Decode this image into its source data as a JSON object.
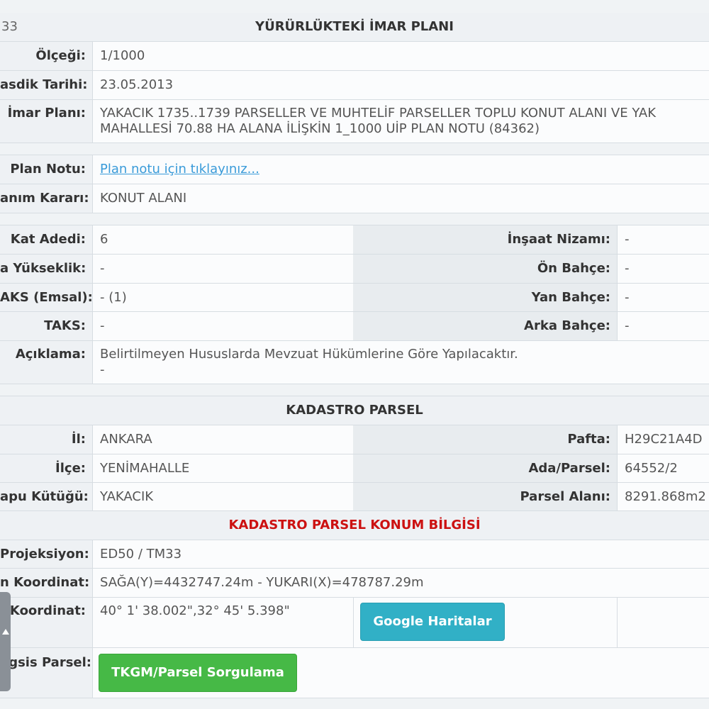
{
  "imar": {
    "header": {
      "left_text": "33",
      "title": "YÜRÜRLÜKTEKİ İMAR PLANI"
    },
    "olcek": {
      "label": "Ölçeği:",
      "value": "1/1000"
    },
    "tasdik": {
      "label": "asdik Tarihi:",
      "value": "23.05.2013"
    },
    "plan": {
      "label": "İmar Planı:",
      "line1": "YAKACIK 1735..1739 PARSELLER VE MUHTELİF PARSELLER TOPLU KONUT ALANI VE YAK",
      "line2": "MAHALLESİ 70.88 HA ALANA İLİŞKİN 1_1000 UİP PLAN NOTU (84362)"
    },
    "plan_notu": {
      "label": "Plan Notu:",
      "link": "Plan notu için tıklayınız..."
    },
    "kullanim": {
      "label": "anım Kararı:",
      "value": "KONUT ALANI"
    },
    "kat": {
      "label": "Kat Adedi:",
      "value": "6",
      "label2": "İnşaat Nizamı:",
      "value2": "-"
    },
    "yukseklik": {
      "label": "a Yükseklik:",
      "value": "-",
      "label2": "Ön Bahçe:",
      "value2": "-"
    },
    "kaks": {
      "label": "AKS (Emsal):",
      "value": "- (1)",
      "label2": "Yan Bahçe:",
      "value2": "-"
    },
    "taks": {
      "label": "TAKS:",
      "value": "-",
      "label2": "Arka Bahçe:",
      "value2": "-"
    },
    "aciklama": {
      "label": "Açıklama:",
      "line1": "Belirtilmeyen Hususlarda Mevzuat Hükümlerine Göre Yapılacaktır.",
      "line2": "-"
    }
  },
  "kadastro": {
    "title": "KADASTRO PARSEL",
    "il": {
      "label": "İl:",
      "value": "ANKARA",
      "label2": "Pafta:",
      "value2": "H29C21A4D"
    },
    "ilce": {
      "label": "İlçe:",
      "value": "YENİMAHALLE",
      "label2": "Ada/Parsel:",
      "value2": "64552/2"
    },
    "tapu": {
      "label": "apu Kütüğü:",
      "value": "YAKACIK",
      "label2": "Parsel Alanı:",
      "value2": "8291.868m2"
    }
  },
  "konum": {
    "title": "KADASTRO PARSEL KONUM BİLGİSİ",
    "projeksiyon": {
      "label": "Projeksiyon:",
      "value": "ED50 / TM33"
    },
    "koordinat1": {
      "label": "n Koordinat:",
      "value": "SAĞA(Y)=4432747.24m - YUKARI(X)=478787.29m"
    },
    "koordinat2": {
      "label": "i Koordinat:",
      "value": "40° 1' 38.002\",32° 45' 5.398\""
    },
    "google_button": "Google Haritalar",
    "megsis": {
      "label": "egsis Parsel:"
    },
    "tkgm_button": "TKGM/Parsel Sorgulama"
  }
}
